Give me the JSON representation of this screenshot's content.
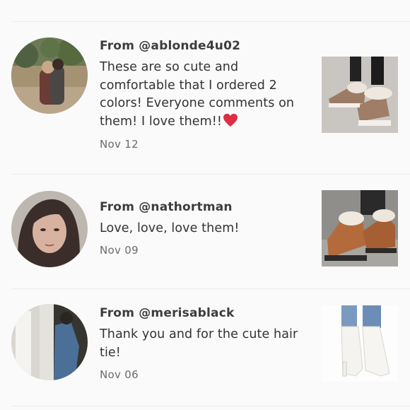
{
  "comments": [
    {
      "author": "From @ablonde4u02",
      "text": "These are so cute and comfortable that I ordered 2 colors! Everyone comments on them! I love them!!",
      "emoji": "heart-emoji",
      "date": "Nov 12"
    },
    {
      "author": "From @nathortman",
      "text": "Love, love, love them!",
      "date": "Nov 09"
    },
    {
      "author": "From @merisablack",
      "text": "Thank you and for the cute hair tie!",
      "date": "Nov 06"
    }
  ]
}
